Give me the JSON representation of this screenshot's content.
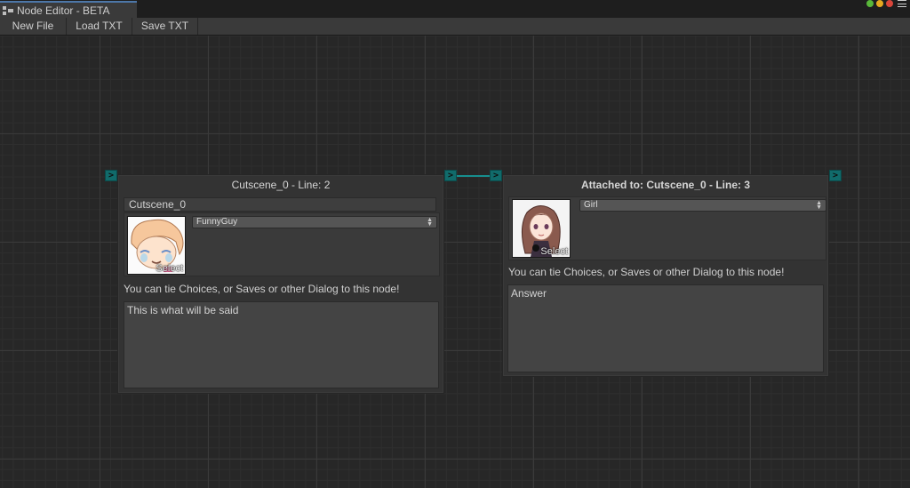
{
  "window": {
    "tab_title": "Node Editor - BETA",
    "buttons": {
      "min_color": "#59b83a",
      "max_color": "#e6a820",
      "close_color": "#d9453a"
    }
  },
  "toolbar": {
    "new_file_label": "New File",
    "load_txt_label": "Load TXT",
    "save_txt_label": "Save TXT"
  },
  "ports": {
    "glyph": ">",
    "color": "#116b6b"
  },
  "nodes": [
    {
      "title": "Cutscene_0 - Line: 2",
      "name_value": "Cutscene_0",
      "character": "FunnyGuy",
      "avatar_button": "Select",
      "hint": "You can tie Choices, or Saves or other Dialog to this node!",
      "dialog_text": "This is what will be said"
    },
    {
      "title": "Attached to: Cutscene_0 - Line: 3",
      "character": "Girl",
      "avatar_button": "Select",
      "hint": "You can tie Choices, or Saves or other Dialog to this node!",
      "dialog_text": "Answer"
    }
  ]
}
